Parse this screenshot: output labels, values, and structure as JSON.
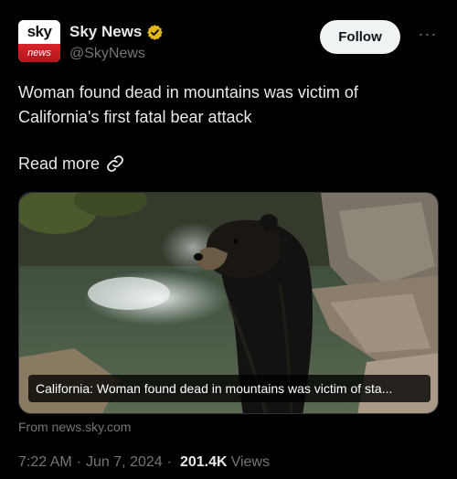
{
  "account": {
    "display_name": "Sky News",
    "handle": "@SkyNews",
    "avatar_top": "sky",
    "avatar_bottom": "news",
    "verified_color": "#e2b719"
  },
  "actions": {
    "follow_label": "Follow",
    "more_label": "···"
  },
  "tweet": {
    "text": "Woman found dead in mountains was victim of California's first fatal bear attack",
    "read_more": "Read more"
  },
  "card": {
    "caption": "California: Woman found dead in mountains was victim of sta...",
    "source": "From news.sky.com"
  },
  "meta": {
    "time": "7:22 AM",
    "separator": "·",
    "date": "Jun 7, 2024",
    "views_count": "201.4K",
    "views_label": "Views"
  },
  "icons": {
    "verified": "verified-badge-icon",
    "link": "link-icon",
    "more": "more-options-icon"
  }
}
